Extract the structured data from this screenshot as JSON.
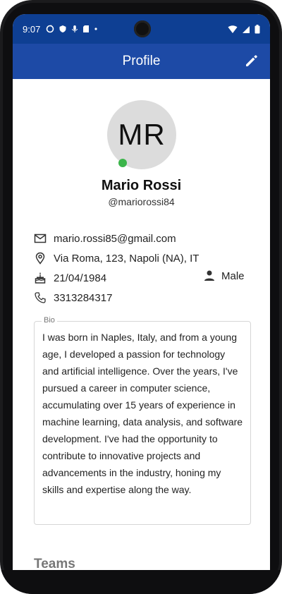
{
  "status_bar": {
    "time": "9:07",
    "icons_left": [
      "sync-icon",
      "shield-icon",
      "microphone-icon",
      "sd-card-icon",
      "dot-icon"
    ],
    "icons_right": [
      "wifi-icon",
      "signal-icon",
      "battery-icon"
    ]
  },
  "app_bar": {
    "title": "Profile",
    "edit_icon": "edit-pencil-icon"
  },
  "profile": {
    "initials": "MR",
    "online_color": "#3bb54a",
    "name": "Mario Rossi",
    "username": "@mariorossi84"
  },
  "info": {
    "email": "mario.rossi85@gmail.com",
    "address": "Via Roma, 123, Napoli (NA), IT",
    "birthdate": "21/04/1984",
    "gender": "Male",
    "phone": "3313284317"
  },
  "bio": {
    "label": "Bio",
    "text": "I was born in Naples, Italy, and from a young age, I developed a passion for technology and artificial intelligence. Over the years, I've pursued a career in computer science, accumulating over 15 years of experience in machine learning, data analysis, and software development. I've had the opportunity to contribute to innovative projects and advancements in the industry, honing my skills and expertise along the way."
  },
  "teams": {
    "title": "Teams"
  },
  "colors": {
    "primary": "#1d4aa6",
    "status_bar": "#0e3f93"
  }
}
